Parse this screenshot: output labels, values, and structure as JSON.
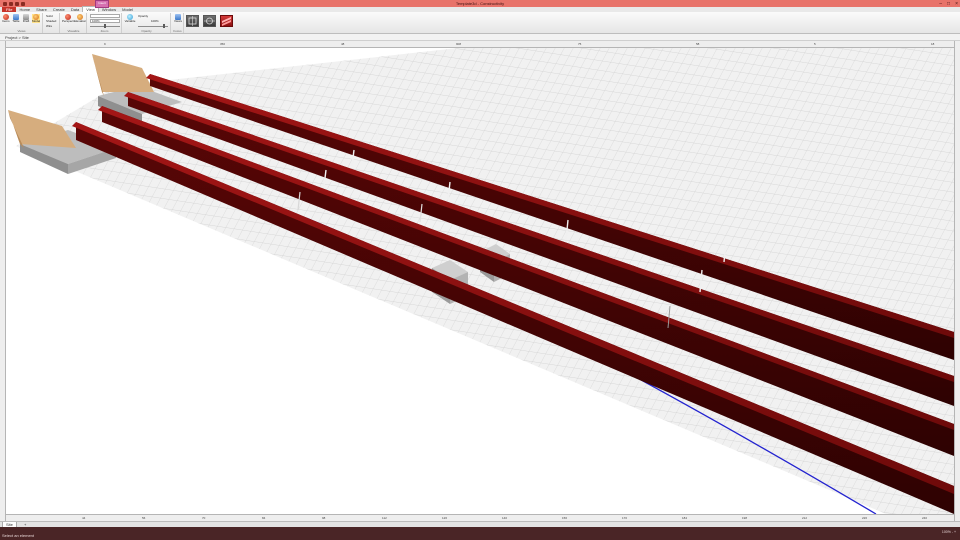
{
  "window": {
    "title": "Template3d - Constructivity"
  },
  "qat_icons": [
    "save-icon",
    "undo-icon",
    "redo-icon",
    "new-icon"
  ],
  "tabs": [
    {
      "label": "File"
    },
    {
      "label": "Home"
    },
    {
      "label": "Share"
    },
    {
      "label": "Create"
    },
    {
      "label": "Data"
    },
    {
      "label": "View"
    },
    {
      "label": "Window"
    },
    {
      "label": "Model"
    }
  ],
  "context_tab": {
    "label": "Insert"
  },
  "ribbon": {
    "buttons": [
      {
        "label": "Items"
      },
      {
        "label": "Table"
      },
      {
        "label": "Draft"
      },
      {
        "label": "Model"
      },
      {
        "label": "Perspective"
      },
      {
        "label": "Elevation"
      },
      {
        "label": "Variable"
      },
      {
        "label": "Views"
      }
    ],
    "style_options": [
      "Solid",
      "Shaded",
      "Wire"
    ],
    "scale_value": "100%",
    "opacity_label": "Opacity",
    "opacity_value": "100%",
    "groups": [
      "Views",
      "Visualize",
      "Zoom",
      "Opacity",
      "Focus"
    ]
  },
  "document": {
    "path": "Project  >  Site"
  },
  "ruler_top_labels": [
    "9",
    "350",
    "48",
    "908",
    "75",
    "58",
    "5",
    "18"
  ],
  "ruler_bottom_labels": [
    "44",
    "56",
    "70",
    "84",
    "98",
    "112",
    "126",
    "140",
    "156",
    "170",
    "184",
    "198",
    "212",
    "226",
    "240"
  ],
  "sheet": {
    "label": "Site",
    "add": "+"
  },
  "status": {
    "text": "Select an element",
    "right": "100%  -  +"
  },
  "colors": {
    "titlebar": "#e8736a",
    "beam": "#7c0c0c",
    "grid": "#d7d7d7",
    "alignment": "#2222cc",
    "statusbar": "#4a2526"
  }
}
